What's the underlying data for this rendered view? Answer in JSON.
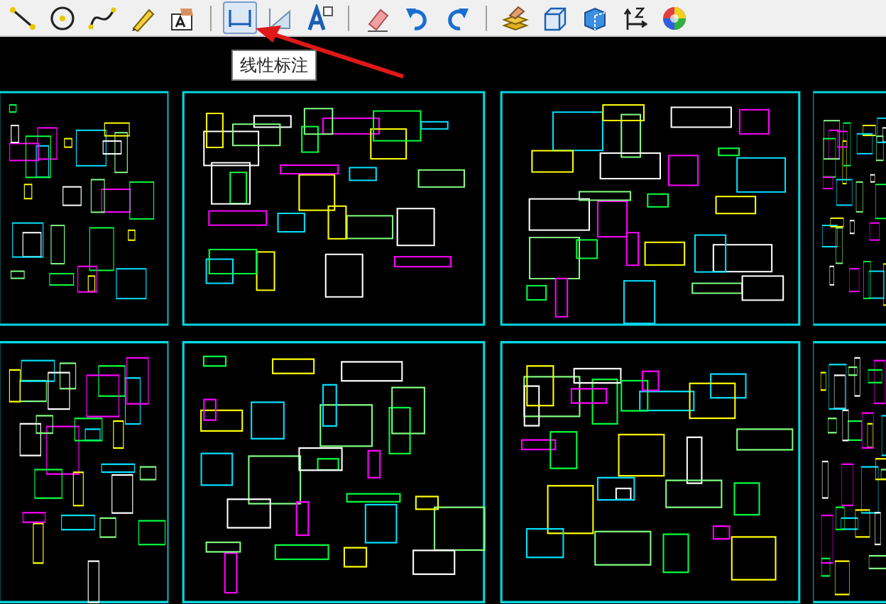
{
  "toolbar": {
    "groups": [
      [
        {
          "kind": "line",
          "selected": false
        },
        {
          "kind": "circle",
          "selected": false
        },
        {
          "kind": "curve",
          "selected": false
        },
        {
          "kind": "pencil",
          "selected": false
        },
        {
          "kind": "text-stamp",
          "selected": false
        }
      ],
      [
        {
          "kind": "linear-dimension",
          "selected": true
        },
        {
          "kind": "aligned-dimension",
          "selected": false
        },
        {
          "kind": "text-style",
          "selected": false
        }
      ],
      [
        {
          "kind": "eraser",
          "selected": false
        },
        {
          "kind": "undo",
          "selected": false
        },
        {
          "kind": "redo",
          "selected": false
        }
      ],
      [
        {
          "kind": "layers",
          "selected": false
        },
        {
          "kind": "box",
          "selected": false
        },
        {
          "kind": "cube",
          "selected": false
        },
        {
          "kind": "axis",
          "selected": false
        },
        {
          "kind": "color-wheel",
          "selected": false
        }
      ]
    ]
  },
  "tooltip": {
    "text": "线性标注"
  }
}
